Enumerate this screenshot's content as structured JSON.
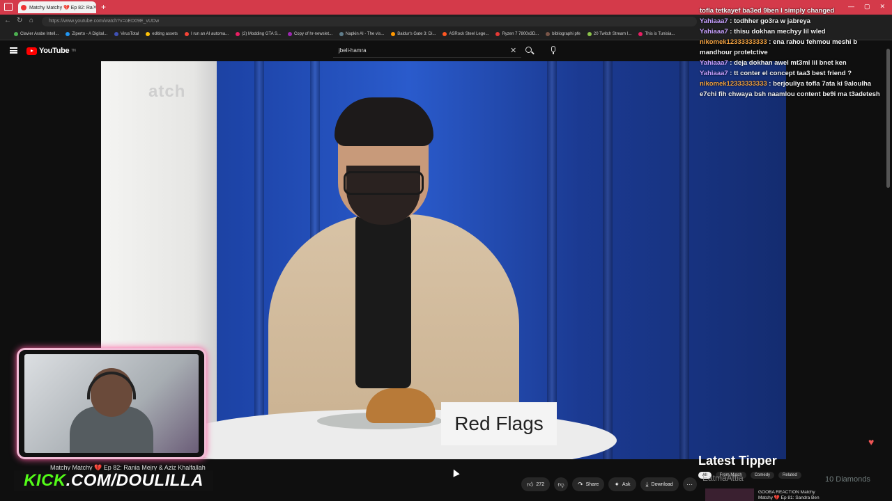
{
  "browser": {
    "tab_title": "Matchy Matchy 💔 Ep 82: Ra",
    "url": "https://www.youtube.com/watch?v=oED09E_vUDw",
    "bookmarks": [
      "Clavier Arabe Intell...",
      "Ziperto - A Digital...",
      "VirusTotal",
      "editing assets",
      "I run an AI automa...",
      "(2) Modding GTA S...",
      "Copy of hr-newslet...",
      "Napkin AI - The vis...",
      "Baldur's Gate 3: Di...",
      "ASRock Steel Lege...",
      "Ryzen 7 7800x3D...",
      "bibliographi pfe",
      "20 Twitch Stream I...",
      "This is Tunisia..."
    ]
  },
  "youtube": {
    "logo_text": "YouTube",
    "logo_sup": "TN",
    "search_value": "jbeli-hamra"
  },
  "video": {
    "wall_text": "atch",
    "sign_text": "Red Flags",
    "title_below": "Matchy Matchy 💔 Ep 82: Rania Mejry & Aziz Khalfallah"
  },
  "overlay": {
    "kick_prefix": "KICK",
    "kick_rest": ".COM/DOULILLA",
    "latest_tipper_label": "Latest Tipper",
    "tipper_name": "EatmaAttia",
    "tipper_amount": "10 Diamonds"
  },
  "actions": {
    "like_count": "272",
    "share_label": "Share",
    "ask_label": "Ask",
    "download_label": "Download"
  },
  "chips": [
    "All",
    "From Match",
    "Comedy",
    "Related"
  ],
  "recommended": {
    "title_line1": "GOOBA REACTION Matchy",
    "title_line2": "Matchy 💔 Ep 81: Sandra Ben"
  },
  "chat": [
    {
      "user": "",
      "text": "tofla tetkayef ba3ed 9ben I simply changed"
    },
    {
      "user": "Yahiaaa7",
      "text": "todhher go3ra w jabreya"
    },
    {
      "user": "Yahiaaa7",
      "text": "thisu dokhan mechyy lil wled"
    },
    {
      "user": "nikomek12333333333",
      "text": "ena rahou fehmou meshi b mandhour protetctive"
    },
    {
      "user": "Yahiaaa7",
      "text": "deja dokhan awel mt3ml lil bnet ken"
    },
    {
      "user": "Yahiaaa7",
      "text": "tt conter el concept taa3 best friend ?"
    },
    {
      "user": "nikomek12333333333",
      "text": "berjouliya tofla 7ata ki 9aloulha e7chi fih chwaya bsh naamlou content be9i ma t3adetesh"
    }
  ]
}
